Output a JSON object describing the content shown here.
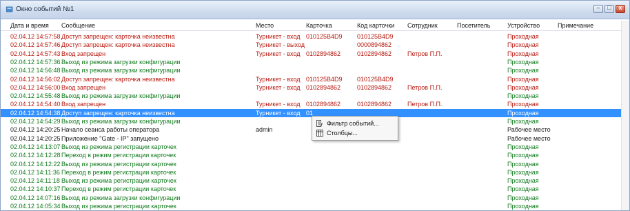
{
  "window": {
    "title": "Окно событий №1",
    "buttons": {
      "minimize": "–",
      "restore": "□",
      "close": "x"
    }
  },
  "columns": [
    "Дата и время",
    "Сообщение",
    "Место",
    "Карточка",
    "Код карточки",
    "Сотрудник",
    "Посетитель",
    "Устройство",
    "Примечание"
  ],
  "rows": [
    {
      "color": "red",
      "cells": [
        "02.04.12 14:57:58",
        "Доступ запрещен: карточка неизвестна",
        "Турникет - вход",
        "010125B4D9",
        "010125B4D9",
        "",
        "",
        "Проходная",
        ""
      ]
    },
    {
      "color": "red",
      "cells": [
        "02.04.12 14:57:46",
        "Доступ запрещен: карточка неизвестна",
        "Турникет - выход",
        "",
        "0000894862",
        "",
        "",
        "Проходная",
        ""
      ]
    },
    {
      "color": "red",
      "cells": [
        "02.04.12 14:57:43",
        "Вход запрещен",
        "Турникет - вход",
        "0102894862",
        "0102894862",
        "Петров П.П.",
        "",
        "Проходная",
        ""
      ]
    },
    {
      "color": "green",
      "cells": [
        "02.04.12 14:57:36",
        "Выход из режима загрузки конфигурации",
        "",
        "",
        "",
        "",
        "",
        "Проходная",
        ""
      ]
    },
    {
      "color": "green",
      "cells": [
        "02.04.12 14:56:48",
        "Выход из режима загрузки конфигурации",
        "",
        "",
        "",
        "",
        "",
        "Проходная",
        ""
      ]
    },
    {
      "color": "red",
      "cells": [
        "02.04.12 14:56:02",
        "Доступ запрещен: карточка неизвестна",
        "Турникет - вход",
        "010125B4D9",
        "010125B4D9",
        "",
        "",
        "Проходная",
        ""
      ]
    },
    {
      "color": "red",
      "cells": [
        "02.04.12 14:56:00",
        "Вход запрещен",
        "Турникет - вход",
        "0102894862",
        "0102894862",
        "Петров П.П.",
        "",
        "Проходная",
        ""
      ]
    },
    {
      "color": "green",
      "cells": [
        "02.04.12 14:55:48",
        "Выход из режима загрузки конфигурации",
        "",
        "",
        "",
        "",
        "",
        "Проходная",
        ""
      ]
    },
    {
      "color": "red",
      "cells": [
        "02.04.12 14:54:40",
        "Вход запрещен",
        "Турникет - вход",
        "0102894862",
        "0102894862",
        "Петров П.П.",
        "",
        "Проходная",
        ""
      ]
    },
    {
      "color": "red",
      "selected": true,
      "cells": [
        "02.04.12 14:54:38",
        "Доступ запрещен: карточка неизвестна",
        "Турникет - вход",
        "01",
        "",
        "",
        "",
        "Проходная",
        ""
      ]
    },
    {
      "color": "green",
      "cells": [
        "02.04.12 14:54:29",
        "Выход из режима загрузки конфигурации",
        "",
        "",
        "",
        "",
        "",
        "Проходная",
        ""
      ]
    },
    {
      "color": "black",
      "cells": [
        "02.04.12 14:20:25",
        "Начало сеанса работы оператора",
        "admin",
        "",
        "",
        "",
        "",
        "Рабочее место",
        ""
      ]
    },
    {
      "color": "black",
      "cells": [
        "02.04.12 14:20:25",
        "Приложение \"Gate - IP\" запущено",
        "",
        "",
        "",
        "",
        "",
        "Рабочее место",
        ""
      ]
    },
    {
      "color": "green",
      "cells": [
        "02.04.12 14:13:07",
        "Выход из режима регистрации карточек",
        "",
        "",
        "",
        "",
        "",
        "Проходная",
        ""
      ]
    },
    {
      "color": "green",
      "cells": [
        "02.04.12 14:12:28",
        "Переход в режим регистрации карточек",
        "",
        "",
        "",
        "",
        "",
        "Проходная",
        ""
      ]
    },
    {
      "color": "green",
      "cells": [
        "02.04.12 14:12:22",
        "Выход из режима регистрации карточек",
        "",
        "",
        "",
        "",
        "",
        "Проходная",
        ""
      ]
    },
    {
      "color": "green",
      "cells": [
        "02.04.12 14:11:36",
        "Переход в режим регистрации карточек",
        "",
        "",
        "",
        "",
        "",
        "Проходная",
        ""
      ]
    },
    {
      "color": "green",
      "cells": [
        "02.04.12 14:11:18",
        "Выход из режима регистрации карточек",
        "",
        "",
        "",
        "",
        "",
        "Проходная",
        ""
      ]
    },
    {
      "color": "green",
      "cells": [
        "02.04.12 14:10:37",
        "Переход в режим регистрации карточек",
        "",
        "",
        "",
        "",
        "",
        "Проходная",
        ""
      ]
    },
    {
      "color": "green",
      "cells": [
        "02.04.12 14:07:16",
        "Выход из режима загрузки конфигурации",
        "",
        "",
        "",
        "",
        "",
        "Проходная",
        ""
      ]
    },
    {
      "color": "green",
      "cells": [
        "02.04.12 14:05:34",
        "Выход из режима регистрации карточек",
        "",
        "",
        "",
        "",
        "",
        "Проходная",
        ""
      ]
    }
  ],
  "context_menu": {
    "items": [
      {
        "label": "Фильтр событий...",
        "icon": "filter-icon"
      },
      {
        "label": "Столбцы...",
        "icon": "columns-icon"
      }
    ]
  },
  "colors": {
    "error": "#b8190f",
    "success": "#0f7a1c",
    "normal": "#1a1a1a",
    "selection": "#3390ff"
  }
}
